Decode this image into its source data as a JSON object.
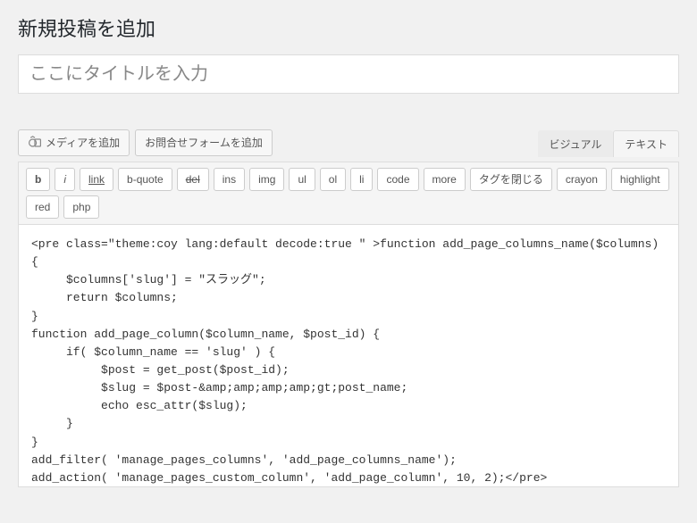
{
  "page": {
    "title": "新規投稿を追加"
  },
  "titleField": {
    "placeholder": "ここにタイトルを入力",
    "value": ""
  },
  "upperButtons": {
    "media": "メディアを追加",
    "contactForm": "お問合せフォームを追加"
  },
  "tabs": {
    "visual": "ビジュアル",
    "text": "テキスト"
  },
  "quicktags": [
    {
      "label": "b",
      "style": "bold"
    },
    {
      "label": "i",
      "style": "italic"
    },
    {
      "label": "link",
      "style": "underline"
    },
    {
      "label": "b-quote",
      "style": ""
    },
    {
      "label": "del",
      "style": "strike"
    },
    {
      "label": "ins",
      "style": ""
    },
    {
      "label": "img",
      "style": ""
    },
    {
      "label": "ul",
      "style": ""
    },
    {
      "label": "ol",
      "style": ""
    },
    {
      "label": "li",
      "style": ""
    },
    {
      "label": "code",
      "style": ""
    },
    {
      "label": "more",
      "style": ""
    },
    {
      "label": "タグを閉じる",
      "style": ""
    },
    {
      "label": "crayon",
      "style": ""
    },
    {
      "label": "highlight",
      "style": ""
    },
    {
      "label": "red",
      "style": ""
    },
    {
      "label": "php",
      "style": ""
    }
  ],
  "editor": {
    "content": "<pre class=\"theme:coy lang:default decode:true \" >function add_page_columns_name($columns)\n{\n     $columns['slug'] = \"スラッグ\";\n     return $columns;\n}\nfunction add_page_column($column_name, $post_id) {\n     if( $column_name == 'slug' ) {\n          $post = get_post($post_id);\n          $slug = $post-&amp;amp;amp;amp;gt;post_name;\n          echo esc_attr($slug);\n     }\n}\nadd_filter( 'manage_pages_columns', 'add_page_columns_name');\nadd_action( 'manage_pages_custom_column', 'add_page_column', 10, 2);</pre>\n"
  }
}
